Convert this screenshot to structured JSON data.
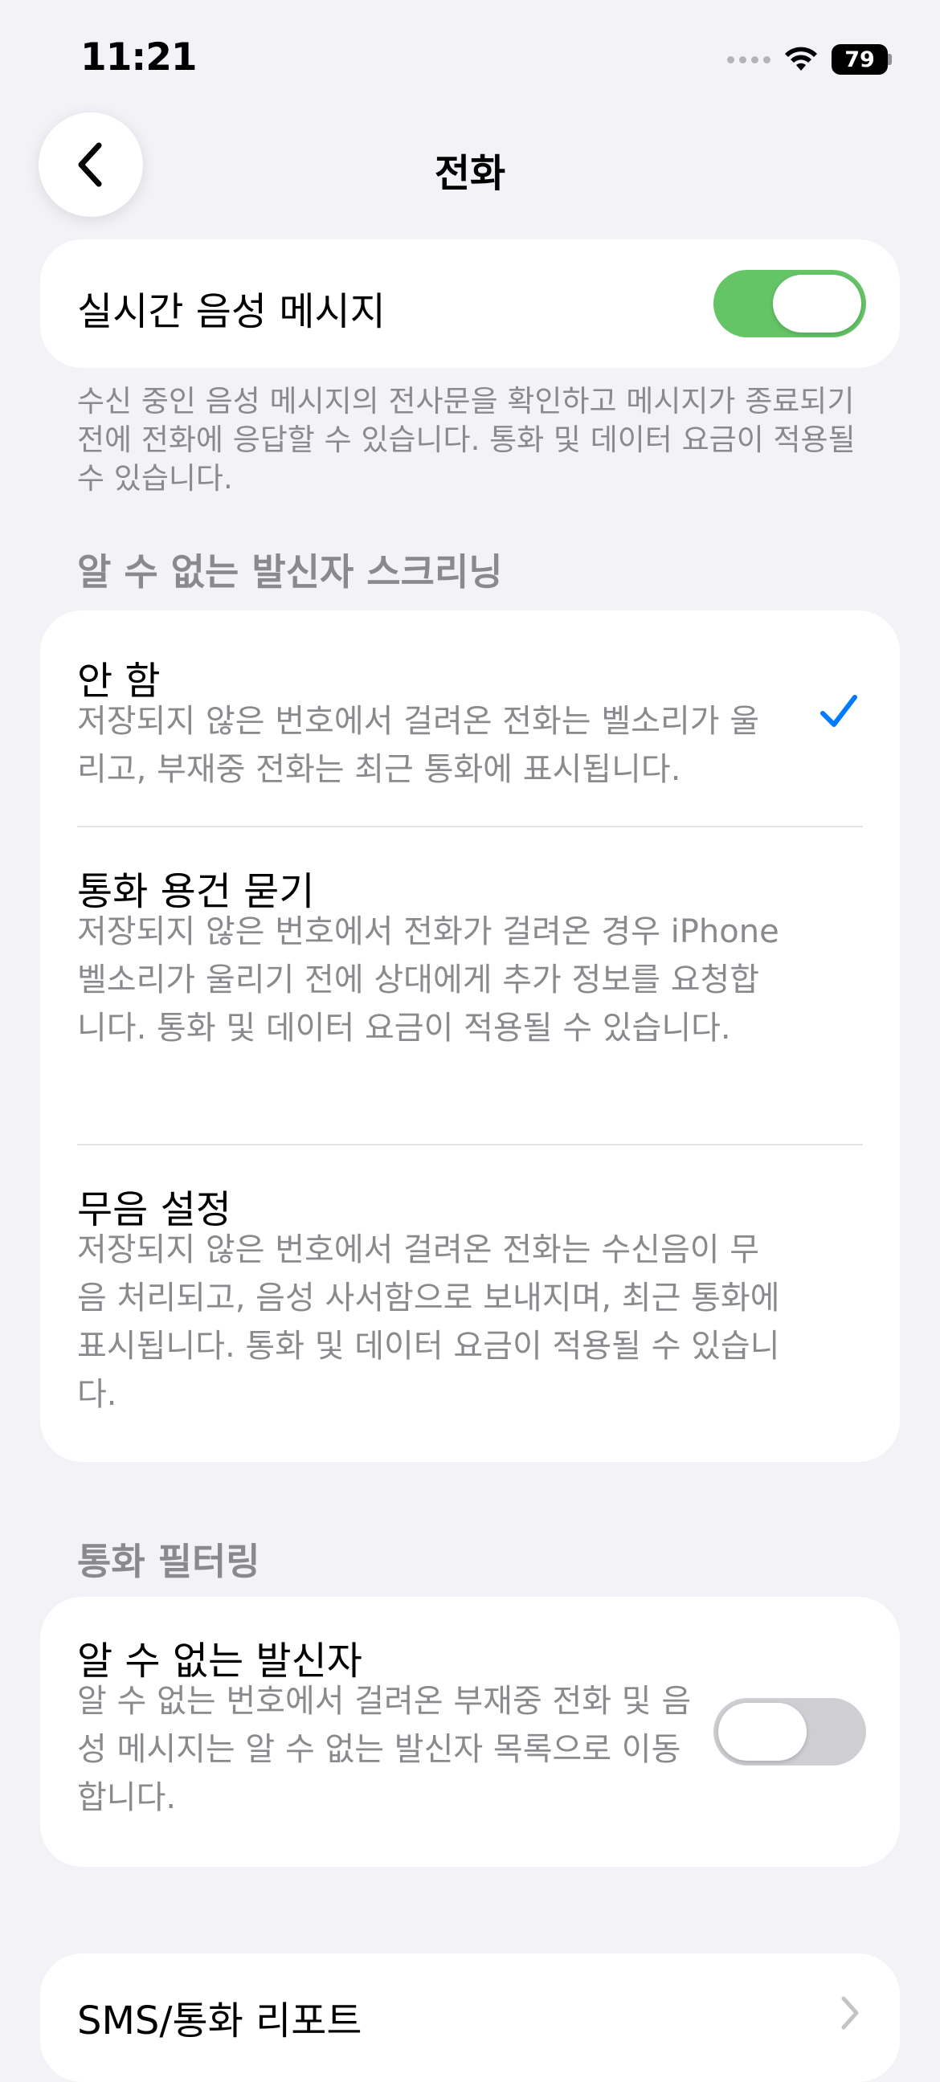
{
  "status_bar": {
    "time": "11:21",
    "battery": "79",
    "icons": [
      "cellular-signal-icon",
      "wifi-icon",
      "battery-icon"
    ]
  },
  "nav": {
    "title": "전화",
    "back_icon": "chevron-left-icon"
  },
  "live_voicemail": {
    "label": "실시간 음성 메시지",
    "enabled": true,
    "footer": "수신 중인 음성 메시지의 전사문을 확인하고 메시지가 종료되기 전에 전화에 응답할 수 있습니다. 통화 및 데이터 요금이 적용될 수 있습니다."
  },
  "screening": {
    "header": "알 수 없는 발신자 스크리닝",
    "options": [
      {
        "title": "안 함",
        "description": "저장되지 않은 번호에서 걸려온 전화는 벨소리가 울리고, 부재중 전화는 최근 통화에 표시됩니다.",
        "selected": true
      },
      {
        "title": "통화 용건 묻기",
        "description": "저장되지 않은 번호에서 전화가 걸려온 경우 iPhone 벨소리가 울리기 전에 상대에게 추가 정보를 요청합니다. 통화 및 데이터 요금이 적용될 수 있습니다.",
        "selected": false
      },
      {
        "title": "무음 설정",
        "description": "저장되지 않은 번호에서 걸려온 전화는 수신음이 무음 처리되고, 음성 사서함으로 보내지며, 최근 통화에 표시됩니다. 통화 및 데이터 요금이 적용될 수 있습니다.",
        "selected": false
      }
    ]
  },
  "call_filtering": {
    "header": "통화 필터링",
    "unknown_senders": {
      "title": "알 수 없는 발신자",
      "description": "알 수 없는 번호에서 걸려온 부재중 전화 및 음성 메시지는 알 수 없는 발신자 목록으로 이동합니다.",
      "enabled": false
    }
  },
  "sms_report": {
    "title": "SMS/통화 리포트"
  },
  "colors": {
    "background": "#F2F2F7",
    "toggle_on": "#65C466",
    "toggle_off": "#CFCFD3",
    "accent": "#007AFF",
    "secondary_text": "#8A8A8E"
  }
}
